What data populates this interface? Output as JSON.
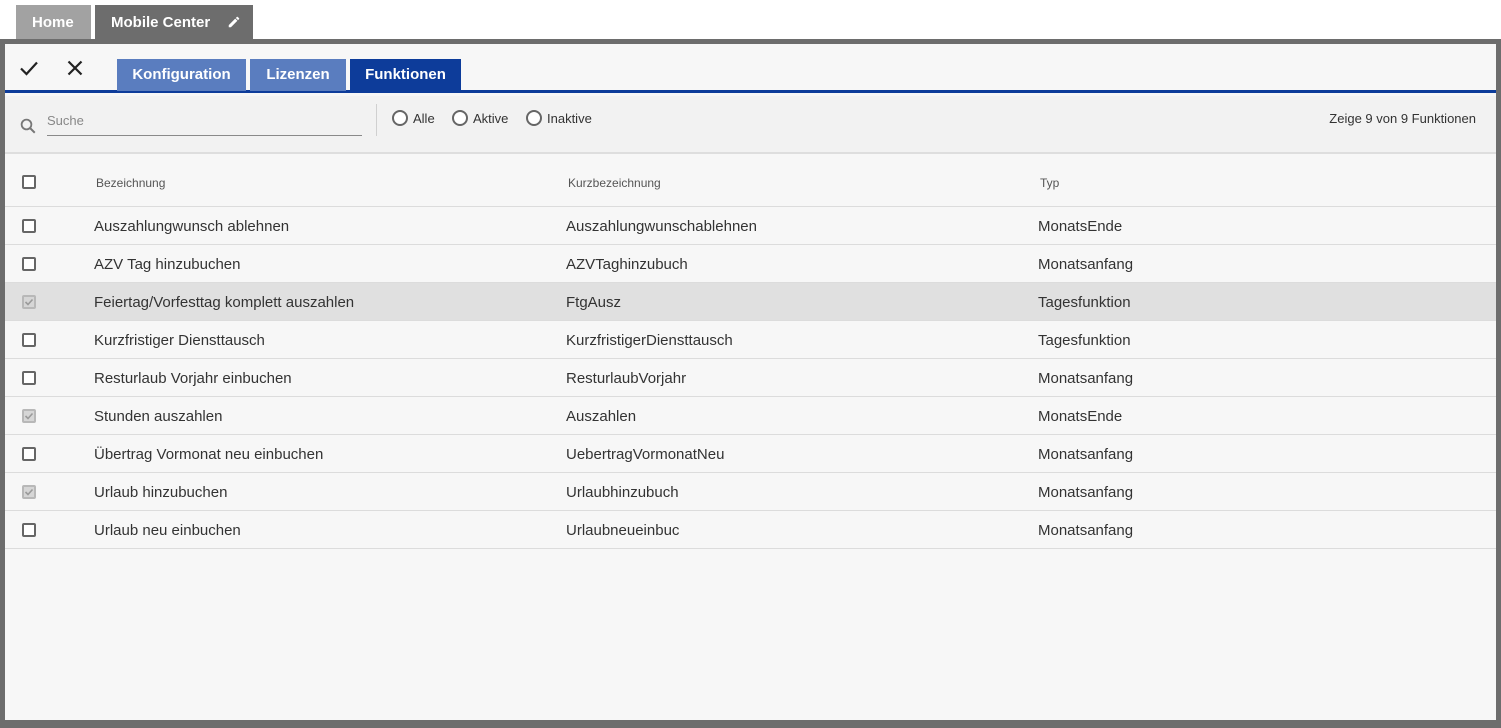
{
  "top_tabs": {
    "home_label": "Home",
    "mobile_center_label": "Mobile Center"
  },
  "toolbar": {
    "confirm_icon": "check-icon",
    "cancel_icon": "close-icon",
    "tabs": [
      {
        "label": "Konfiguration",
        "active": false
      },
      {
        "label": "Lizenzen",
        "active": false
      },
      {
        "label": "Funktionen",
        "active": true
      }
    ]
  },
  "filter": {
    "search_placeholder": "Suche",
    "search_value": "",
    "radio_options": [
      "Alle",
      "Aktive",
      "Inaktive"
    ],
    "selected": "",
    "count_text": "Zeige 9 von 9 Funktionen"
  },
  "table": {
    "columns": [
      "Bezeichnung",
      "Kurzbezeichnung",
      "Typ"
    ],
    "rows": [
      {
        "bezeichnung": "Auszahlungwunsch ablehnen",
        "kurz": "Auszahlungwunschablehnen",
        "typ": "MonatsEnde",
        "checked": false
      },
      {
        "bezeichnung": "AZV Tag hinzubuchen",
        "kurz": "AZVTaghinzubuch",
        "typ": "Monatsanfang",
        "checked": false
      },
      {
        "bezeichnung": "Feiertag/Vorfesttag komplett auszahlen",
        "kurz": "FtgAusz",
        "typ": "Tagesfunktion",
        "checked": true
      },
      {
        "bezeichnung": "Kurzfristiger Diensttausch",
        "kurz": "KurzfristigerDiensttausch",
        "typ": "Tagesfunktion",
        "checked": false
      },
      {
        "bezeichnung": "Resturlaub Vorjahr einbuchen",
        "kurz": "ResturlaubVorjahr",
        "typ": "Monatsanfang",
        "checked": false
      },
      {
        "bezeichnung": "Stunden auszahlen",
        "kurz": "Auszahlen",
        "typ": "MonatsEnde",
        "checked": true
      },
      {
        "bezeichnung": "Übertrag Vormonat neu einbuchen",
        "kurz": "UebertragVormonatNeu",
        "typ": "Monatsanfang",
        "checked": false
      },
      {
        "bezeichnung": "Urlaub hinzubuchen",
        "kurz": "Urlaubhinzubuch",
        "typ": "Monatsanfang",
        "checked": true
      },
      {
        "bezeichnung": "Urlaub neu einbuchen",
        "kurz": "Urlaubneueinbuc",
        "typ": "Monatsanfang",
        "checked": false
      }
    ]
  },
  "colors": {
    "tab_active": "#0d3c9a",
    "tab_inactive": "#5a7dbf",
    "frame": "#6d6d6d",
    "row_highlight": "#e0e0e0"
  }
}
